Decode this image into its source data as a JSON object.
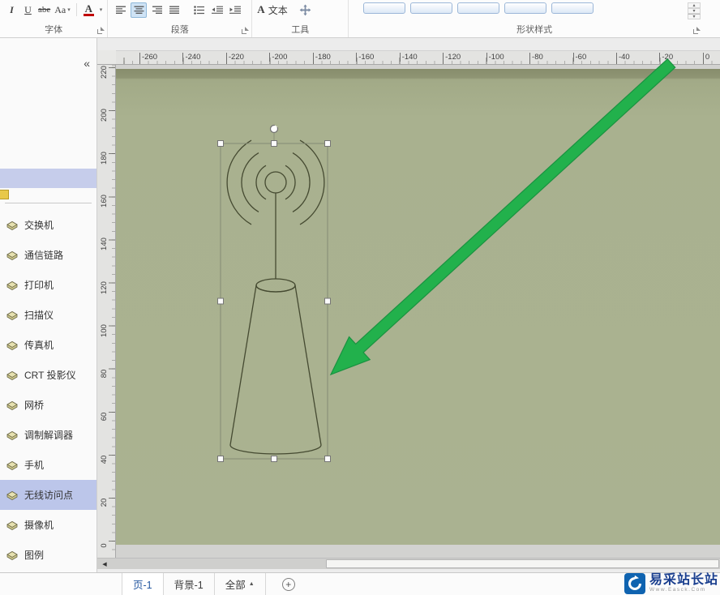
{
  "colors": {
    "canvas_green": "#a9b18f",
    "page_edge": "#878d6c",
    "arrow_green": "#22b14c",
    "arrow_border": "#1a9240",
    "selection_highlight": "#bcc6ea",
    "stencil_strip": "#c6cdeb",
    "shape_outline": "#454a31",
    "font_color_red": "#c00000"
  },
  "icons": {
    "chevron_down": "▾",
    "gallery_up": "▴",
    "gallery_down": "▾",
    "gallery_more": "▾",
    "scroll_left": "◀",
    "collapse": "«"
  },
  "ribbon": {
    "font_group": {
      "label": "字体",
      "italic": "I",
      "underline": "U",
      "strikethrough": "abe",
      "case_button": "Aa",
      "font_color": "A"
    },
    "paragraph_group": {
      "label": "段落"
    },
    "tools_group": {
      "label": "工具",
      "text_tool_prefix": "A",
      "text_tool": "文本"
    },
    "shape_styles_group": {
      "label": "形状样式"
    }
  },
  "sidebar": {
    "items": [
      {
        "id": "switch",
        "label": "交换机",
        "icon": "switch-icon"
      },
      {
        "id": "comm-link",
        "label": "通信链路",
        "icon": "comm-link-icon"
      },
      {
        "id": "printer",
        "label": "打印机",
        "icon": "printer-icon"
      },
      {
        "id": "scanner",
        "label": "扫描仪",
        "icon": "scanner-icon"
      },
      {
        "id": "fax",
        "label": "传真机",
        "icon": "fax-icon"
      },
      {
        "id": "crt-projector",
        "label": "CRT 投影仪",
        "icon": "crt-projector-icon"
      },
      {
        "id": "bridge",
        "label": "网桥",
        "icon": "bridge-icon"
      },
      {
        "id": "modem",
        "label": "调制解调器",
        "icon": "modem-icon"
      },
      {
        "id": "mobile-phone",
        "label": "手机",
        "icon": "mobile-phone-icon"
      },
      {
        "id": "wireless-ap",
        "label": "无线访问点",
        "icon": "wireless-ap-icon",
        "selected": true
      },
      {
        "id": "camera",
        "label": "摄像机",
        "icon": "camera-icon"
      },
      {
        "id": "legend",
        "label": "图例",
        "icon": "legend-icon"
      }
    ]
  },
  "rulers": {
    "horizontal": [
      "-260",
      "-240",
      "-220",
      "-200",
      "-180",
      "-160",
      "-140",
      "-120",
      "-100",
      "-80",
      "-60",
      "-40",
      "-20",
      "0"
    ],
    "vertical": [
      "220",
      "200",
      "180",
      "160",
      "140",
      "120",
      "100",
      "80",
      "60",
      "40",
      "20",
      "0"
    ]
  },
  "tabbar": {
    "tabs": [
      {
        "label": "页-1",
        "active": true
      },
      {
        "label": "背景-1",
        "active": false
      },
      {
        "label": "全部",
        "active": false,
        "arrow": "▲"
      }
    ],
    "add_label": "+"
  },
  "brand": {
    "title": "易采站长站",
    "subtitle": "Www.Easck.Com"
  }
}
